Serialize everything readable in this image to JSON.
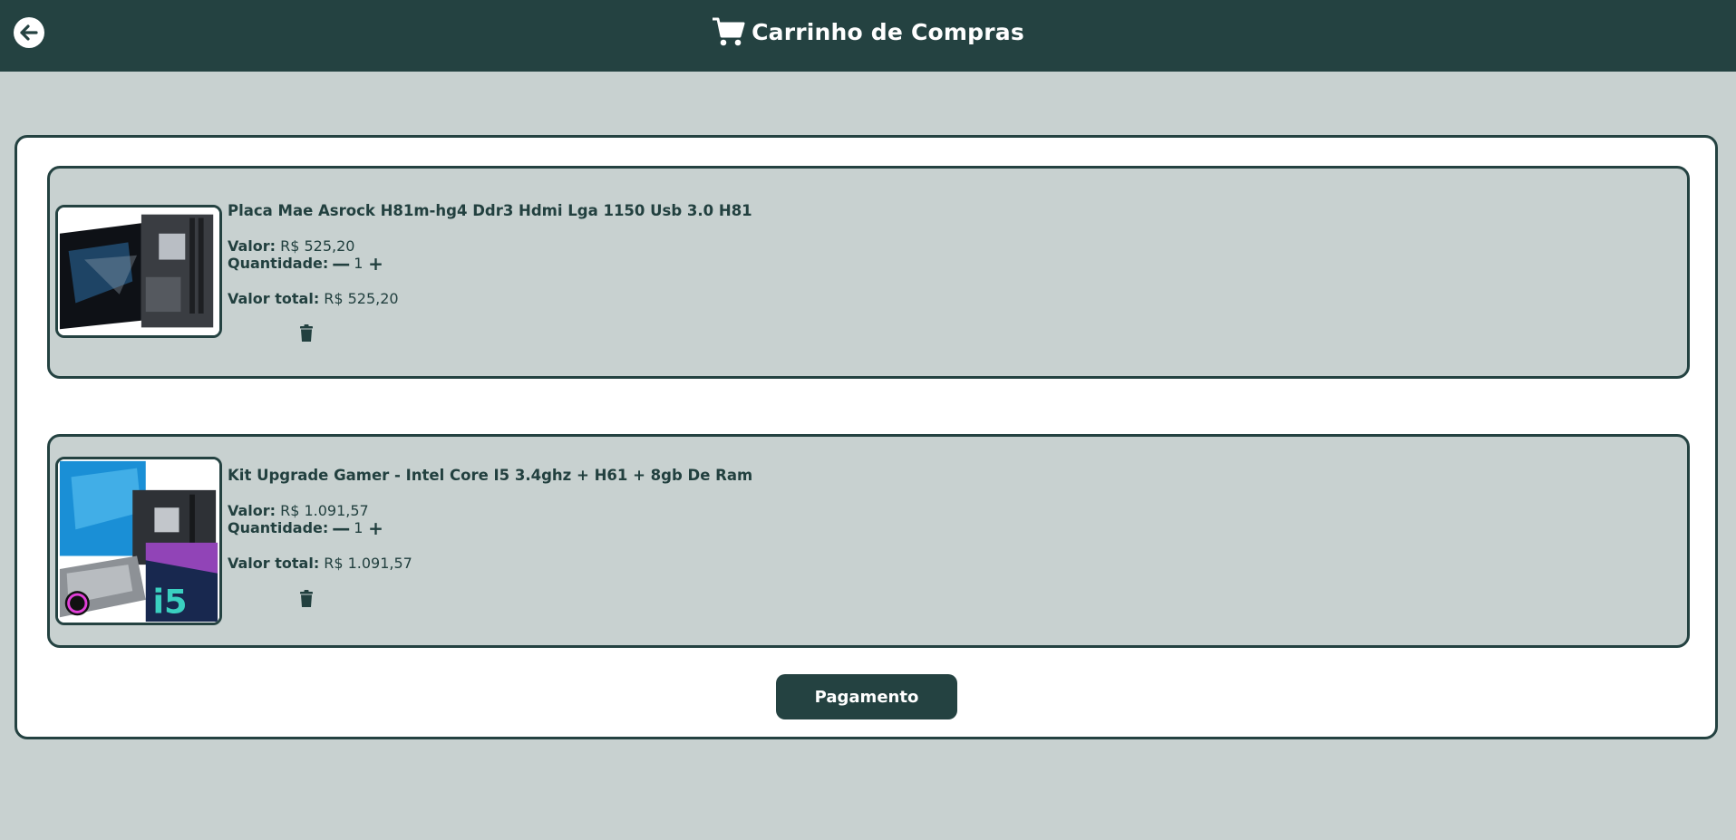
{
  "header": {
    "title": "Carrinho de Compras",
    "back_icon": "arrow-left-icon",
    "cart_icon": "shopping-cart-icon"
  },
  "cart": {
    "items": [
      {
        "name": "Placa Mae Asrock H81m-hg4 Ddr3 Hdmi Lga 1150 Usb 3.0 H81",
        "price_label": "Valor:",
        "price": "R$ 525,20",
        "quantity_label": "Quantidade:",
        "quantity": "1",
        "decrement": "—",
        "increment": "+",
        "total_label": "Valor total:",
        "total": "R$ 525,20"
      },
      {
        "name": "Kit Upgrade Gamer - Intel Core I5 3.4ghz + H61 + 8gb De Ram",
        "price_label": "Valor:",
        "price": "R$ 1.091,57",
        "quantity_label": "Quantidade:",
        "quantity": "1",
        "decrement": "—",
        "increment": "+",
        "total_label": "Valor total:",
        "total": "R$ 1.091,57"
      }
    ],
    "payment_button": "Pagamento"
  },
  "colors": {
    "primary": "#244241",
    "background": "#c8d1d0",
    "card": "#ffffff"
  }
}
